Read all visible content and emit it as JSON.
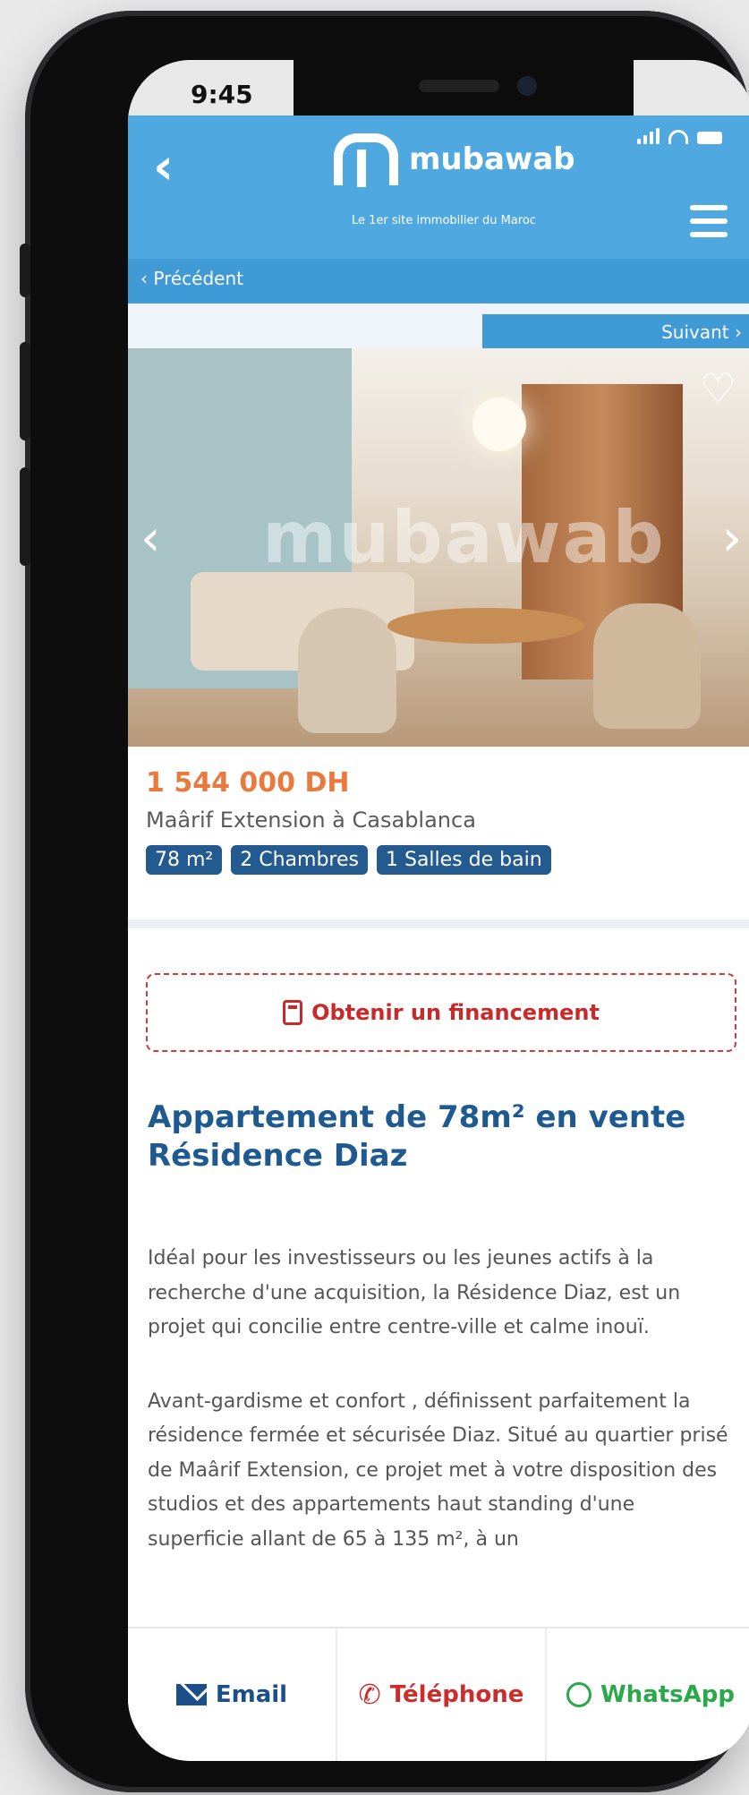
{
  "status": {
    "time": "9:45"
  },
  "header": {
    "logo_text": "mubawab",
    "tagline": "Le 1er site immobilier du Maroc"
  },
  "nav": {
    "previous": "Précédent",
    "next": "Suivant"
  },
  "photo": {
    "watermark": "mubawab"
  },
  "listing": {
    "price": "1 544 000 DH",
    "location": "Maârif Extension à Casablanca",
    "tags": [
      "78 m²",
      "2 Chambres",
      "1 Salles de bain"
    ]
  },
  "finance_button": "Obtenir un financement",
  "title": "Appartement de 78m² en vente Résidence Diaz",
  "description": [
    "Idéal pour les investisseurs ou les jeunes actifs à la recherche d'une acquisition, la Résidence Diaz, est un projet qui concilie entre centre-ville et calme inouï.",
    "Avant-gardisme et confort , définissent parfaitement la résidence fermée et sécurisée Diaz. Situé au quartier prisé de Maârif Extension, ce projet met à votre disposition des studios et des appartements haut standing d'une superficie allant de 65 à 135 m², à un"
  ],
  "bottom_bar": {
    "email": "Email",
    "phone": "Téléphone",
    "whatsapp": "WhatsApp"
  }
}
